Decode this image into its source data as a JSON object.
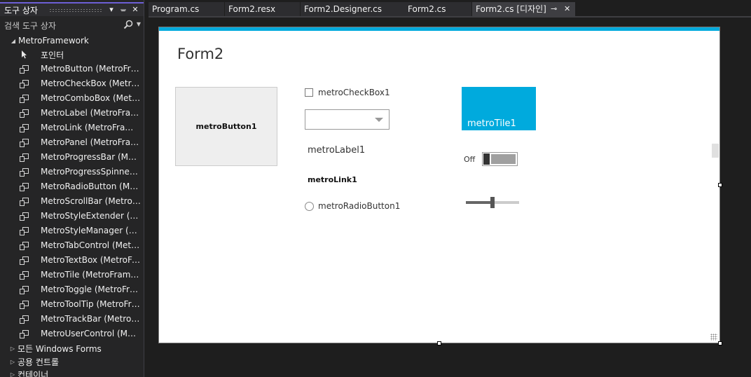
{
  "toolbox": {
    "title": "도구 상자",
    "search_label": "검색 도구 상자",
    "groups": [
      {
        "label": "MetroFramework",
        "expanded": true
      },
      {
        "label": "모든 Windows Forms",
        "expanded": false
      },
      {
        "label": "공용 컨트롤",
        "expanded": false
      },
      {
        "label": "컨테이너",
        "expanded": false
      }
    ],
    "items": [
      {
        "label": "포인터",
        "icon": "pointer-icon"
      },
      {
        "label": "MetroButton (MetroFra...",
        "icon": "component-icon"
      },
      {
        "label": "MetroCheckBox (MetroF...",
        "icon": "component-icon"
      },
      {
        "label": "MetroComboBox (Metro...",
        "icon": "component-icon"
      },
      {
        "label": "MetroLabel (MetroFrame...",
        "icon": "component-icon"
      },
      {
        "label": "MetroLink (MetroFrame...",
        "icon": "component-icon"
      },
      {
        "label": "MetroPanel (MetroFrame...",
        "icon": "component-icon"
      },
      {
        "label": "MetroProgressBar (Metro...",
        "icon": "component-icon"
      },
      {
        "label": "MetroProgressSpinner (...",
        "icon": "component-icon"
      },
      {
        "label": "MetroRadioButton (Metr...",
        "icon": "component-icon"
      },
      {
        "label": "MetroScrollBar (MetroFr...",
        "icon": "component-icon"
      },
      {
        "label": "MetroStyleExtender (Met...",
        "icon": "component-icon"
      },
      {
        "label": "MetroStyleManager (Met...",
        "icon": "component-icon"
      },
      {
        "label": "MetroTabControl (Metro...",
        "icon": "component-icon"
      },
      {
        "label": "MetroTextBox (MetroFra...",
        "icon": "component-icon"
      },
      {
        "label": "MetroTile (MetroFramew...",
        "icon": "component-icon"
      },
      {
        "label": "MetroToggle (MetroFra...",
        "icon": "component-icon"
      },
      {
        "label": "MetroToolTip (MetroFra...",
        "icon": "component-icon"
      },
      {
        "label": "MetroTrackBar (MetroFra...",
        "icon": "component-icon"
      },
      {
        "label": "MetroUserControl (Metr...",
        "icon": "component-icon"
      }
    ]
  },
  "tabs": [
    {
      "label": "Program.cs",
      "active": false
    },
    {
      "label": "Form2.resx",
      "active": false
    },
    {
      "label": "Form2.Designer.cs",
      "active": false
    },
    {
      "label": "Form2.cs",
      "active": false
    },
    {
      "label": "Form2.cs [디자인]",
      "active": true
    }
  ],
  "form": {
    "title": "Form2",
    "accent_color": "#00aadd",
    "button_label": "metroButton1",
    "checkbox_label": "metroCheckBox1",
    "checkbox_checked": false,
    "combobox_value": "",
    "label_text": "metroLabel1",
    "link_text": "metroLink1",
    "radio_label": "metroRadioButton1",
    "radio_checked": false,
    "tile_label": "metroTile1",
    "tile_color": "#00aadd",
    "toggle_label": "Off",
    "toggle_on": false,
    "trackbar_fraction": 0.5
  }
}
